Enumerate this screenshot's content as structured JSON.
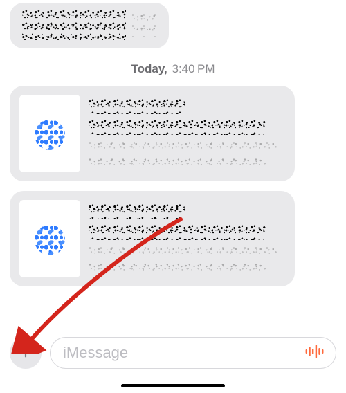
{
  "timestamp": {
    "day": "Today,",
    "time": "3:40 PM"
  },
  "colors": {
    "bubble_bg": "#e9e9eb",
    "placeholder": "#bdbdc2",
    "plus_bg": "#e6e6e9",
    "plus_fg": "#7c7c82",
    "audio_accent": "#ff6a3d",
    "border": "#d8d8dc",
    "annotation_arrow": "#d4251c"
  },
  "composer": {
    "placeholder": "iMessage"
  },
  "icons": {
    "plus": "plus-icon",
    "audio": "audio-waveform-icon"
  }
}
